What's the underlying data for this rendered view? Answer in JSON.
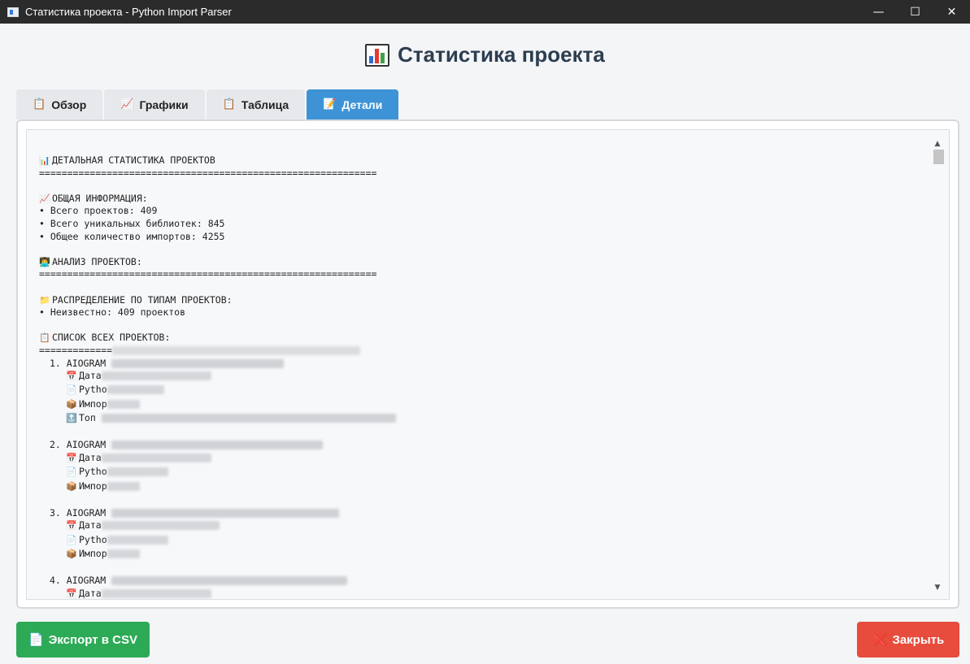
{
  "window": {
    "title": "Статистика проекта - Python Import Parser",
    "minimize": "—",
    "maximize": "☐",
    "close": "✕"
  },
  "heading": {
    "text": "Статистика проекта"
  },
  "tabs": [
    {
      "label": "Обзор",
      "icon": "clipboard-icon",
      "glyph": "📋",
      "active": false
    },
    {
      "label": "Графики",
      "icon": "chart-increasing-icon",
      "glyph": "📈",
      "active": false
    },
    {
      "label": "Таблица",
      "icon": "clipboard-icon",
      "glyph": "📋",
      "active": false
    },
    {
      "label": "Детали",
      "icon": "memo-icon",
      "glyph": "📝",
      "active": true
    }
  ],
  "details": {
    "title": "ДЕТАЛЬНАЯ СТАТИСТИКА ПРОЕКТОВ",
    "separator": "============================================================",
    "general_header": "ОБЩАЯ ИНФОРМАЦИЯ:",
    "total_projects": "• Всего проектов: 409",
    "unique_libs": "• Всего уникальных библиотек: 845",
    "total_imports": "• Общее количество импортов: 4255",
    "analysis_header": "АНАЛИЗ ПРОЕКТОВ:",
    "distribution_header": "РАСПРЕДЕЛЕНИЕ ПО ТИПАМ ПРОЕКТОВ:",
    "unknown": "• Неизвестно: 409 проектов",
    "list_header": "СПИСОК ВСЕХ ПРОЕКТОВ:",
    "list_separator": "=============",
    "projects": [
      {
        "name": "1. AIOGRAM",
        "date": "Дата",
        "python": "Pytho",
        "imports": "Импор",
        "top": "Топ"
      },
      {
        "name": "2. AIOGRAM",
        "date": "Дата",
        "python": "Pytho",
        "imports": "Импор"
      },
      {
        "name": "3. AIOGRAM",
        "date": "Дата",
        "python": "Pytho",
        "imports": "Импор"
      },
      {
        "name": "4. AIOGRAM",
        "date": "Дата"
      }
    ]
  },
  "buttons": {
    "export": "Экспорт в CSV",
    "close": "Закрыть"
  },
  "colors": {
    "titlebar": "#2b2b2b",
    "active_tab": "#3d93d6",
    "export": "#2daa56",
    "close": "#e74c3c",
    "heading": "#2c3e50"
  }
}
